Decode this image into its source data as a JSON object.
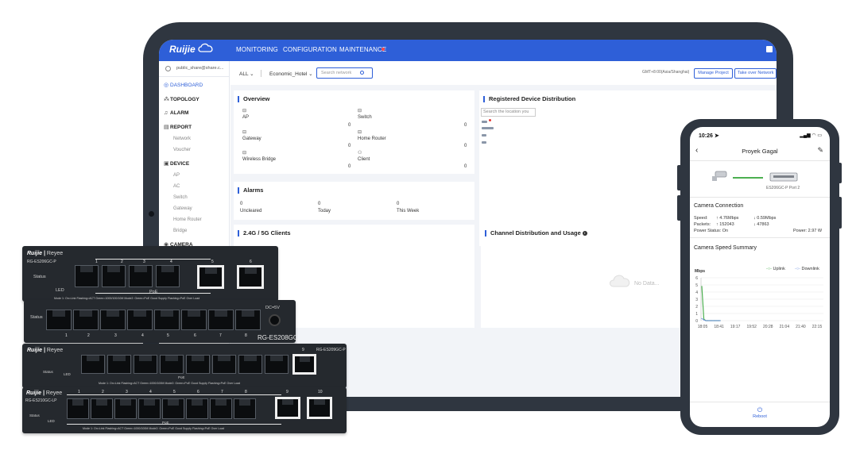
{
  "tablet": {
    "brand": "Ruijie",
    "nav": {
      "monitoring": "MONITORING",
      "configuration": "CONFIGURATION",
      "maintenance": "MAINTENANCE"
    },
    "user": "public_share@share.c...",
    "sidebar": {
      "dashboard": "DASHBOARD",
      "topology": "TOPOLOGY",
      "alarm": "ALARM",
      "report": "REPORT",
      "report_items": [
        "Network",
        "Voucher"
      ],
      "device": "DEVICE",
      "device_items": [
        "AP",
        "AC",
        "Switch",
        "Gateway",
        "Home Router",
        "Bridge"
      ],
      "camera": "CAMERA"
    },
    "toolbar": {
      "all": "ALL",
      "project": "Economic_Hotel",
      "search_placeholder": "Search network",
      "timezone": "GMT+8:00(Asia/Shanghai)",
      "manage_project": "Manage Project",
      "take_over": "Take over Network"
    },
    "overview": {
      "title": "Overview",
      "items": [
        {
          "label": "AP",
          "value": "0"
        },
        {
          "label": "Switch",
          "value": "0"
        },
        {
          "label": "Gateway",
          "value": "0"
        },
        {
          "label": "Home Router",
          "value": "0"
        },
        {
          "label": "Wireless Bridge",
          "value": "0"
        },
        {
          "label": "Client",
          "value": "0"
        }
      ]
    },
    "registered": {
      "title": "Registered Device Distribution",
      "search_placeholder": "Search the location you"
    },
    "alarms": {
      "title": "Alarms",
      "items": [
        {
          "label": "Uncleared",
          "value": "0"
        },
        {
          "label": "Today",
          "value": "0"
        },
        {
          "label": "This Week",
          "value": "0"
        }
      ]
    },
    "clients": {
      "title": "2.4G / 5G Clients"
    },
    "channel": {
      "title": "Channel Distribution and Usage",
      "empty": "No Data..."
    }
  },
  "switches": {
    "s1": {
      "brand": "Ruijie",
      "sub": "Reyee",
      "model": "RG-ES206GC-P",
      "status": "Status",
      "led": "LED",
      "poe": "PoE",
      "mode": "Mode 1: On=Link Flashing=ACT Green=1000/100/10M    Mode2: Green=PoE Good Supply Flashing=PoE Over Load",
      "ports": [
        "1",
        "2",
        "3",
        "4",
        "5",
        "6"
      ]
    },
    "s2": {
      "status": "Status",
      "dc": "DC=5V",
      "model": "RG-ES208GC",
      "ports": [
        "1",
        "2",
        "3",
        "4",
        "5",
        "6",
        "7",
        "8"
      ]
    },
    "s3": {
      "brand": "Ruijie",
      "sub": "Reyee",
      "model": "RG-ES209GC-P",
      "status": "Status",
      "led": "LED",
      "poe": "PoE",
      "mode": "Mode 1: On=Link Flashing=ACT Green=1000/100M    Mode2: Green=PoE Good Supply Flashing=PoE Over Load",
      "ports": [
        "1",
        "2",
        "3",
        "4",
        "5",
        "6",
        "7",
        "8",
        "9"
      ]
    },
    "s4": {
      "brand": "Ruijie",
      "sub": "Reyee",
      "model": "RG-ES210GC-LP",
      "status": "Status",
      "led": "LED",
      "poe": "PoE",
      "mode": "Mode 1: On=Link Flashing=ACT Green=1000/100M    Mode2: Green=PoE Good Supply Flashing=PoE Over Load",
      "ports": [
        "1",
        "2",
        "3",
        "4",
        "5",
        "6",
        "7",
        "8",
        "9",
        "10"
      ]
    }
  },
  "phone": {
    "time": "10:26",
    "title": "Proyek Gagal",
    "device_label": "ES206GC-P Port 2",
    "camera_connection": "Camera Connection",
    "speed_label": "Speed:",
    "speed_up": "↑ 4.76Mbps",
    "speed_down": "↓ 0.59Mbps",
    "packets_label": "Packets:",
    "packets_up": "↑ 152043",
    "packets_down": "↓ 47863",
    "power_status": "Power Status:  On",
    "power": "Power:  2.97 W",
    "speed_summary": "Camera Speed Summary",
    "legend_uplink": "Uplink",
    "legend_downlink": "Downlink",
    "reboot": "Reboot",
    "accent": "#2e5fd8",
    "uplink_color": "#4caf50",
    "downlink_color": "#6c8fe0"
  },
  "chart_data": {
    "type": "line",
    "title": "",
    "xlabel": "",
    "ylabel": "Mbps",
    "x": [
      "18:05",
      "18:41",
      "19:17",
      "19:52",
      "20:28",
      "21:04",
      "21:40",
      "22:15"
    ],
    "ylim": [
      0,
      6
    ],
    "yticks": [
      "0",
      "1",
      "2",
      "3",
      "4",
      "5",
      "6"
    ],
    "grid": true,
    "legend": "top-right",
    "series": [
      {
        "name": "Uplink",
        "values": [
          4.8,
          0.2,
          0,
          0,
          0,
          0,
          0,
          0,
          0,
          0
        ]
      },
      {
        "name": "Downlink",
        "values": [
          0.3,
          0.1,
          0,
          0,
          0,
          0,
          0,
          0,
          0,
          0
        ]
      }
    ]
  }
}
